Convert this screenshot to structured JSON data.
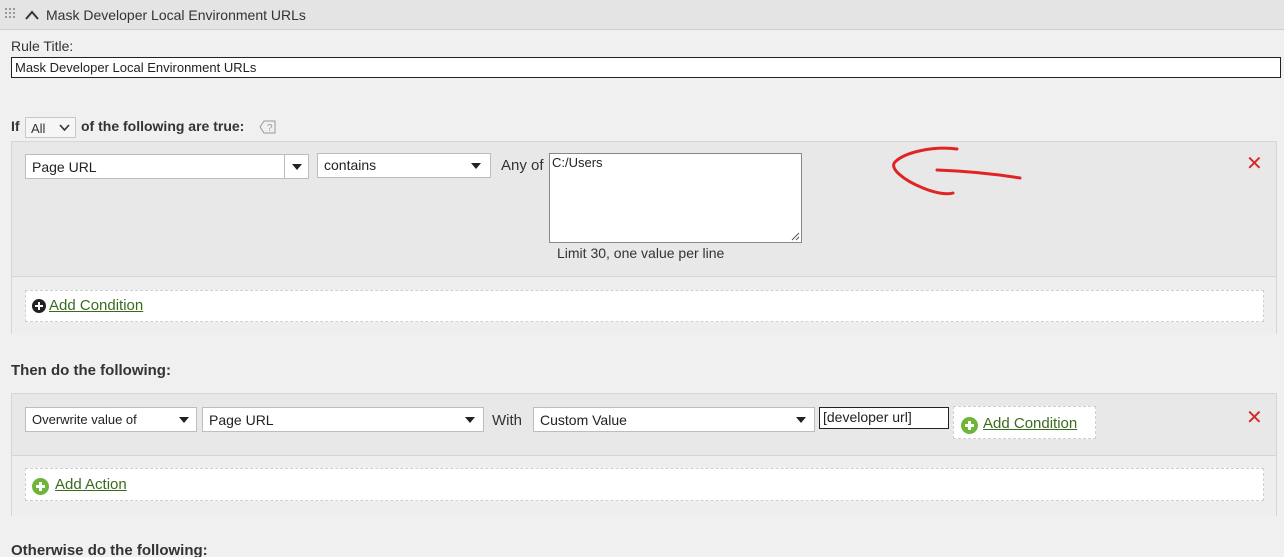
{
  "header": {
    "title": "Mask Developer Local Environment URLs"
  },
  "rule_title": {
    "label": "Rule Title:",
    "value": "Mask Developer Local Environment URLs"
  },
  "condition_intro": {
    "if_label": "If",
    "match_selected": "All",
    "suffix_label": "of the following are true:"
  },
  "condition": {
    "field": "Page URL",
    "operator": "contains",
    "any_of_label": "Any of",
    "values_text": "C:/Users",
    "hint": "Limit 30, one value per line"
  },
  "add_condition_label": "Add Condition",
  "actions_heading": "Then do the following:",
  "action": {
    "type": "Overwrite value of",
    "field": "Page URL",
    "with_label": "With",
    "value_type": "Custom Value",
    "custom_value": "[developer url]",
    "add_condition_label": "Add Condition"
  },
  "add_action_label": "Add Action",
  "otherwise_heading": "Otherwise do the following:",
  "colors": {
    "remove": "#d62a2a",
    "link": "#3a6b1d",
    "add_green": "#6fb53a",
    "annotation": "#e02424"
  },
  "icons": [
    "grip-icon",
    "chevron-up-icon",
    "chevron-down-icon",
    "help-icon",
    "dropdown-arrow-icon",
    "resize-handle-icon",
    "close-icon",
    "add-circle-icon"
  ]
}
